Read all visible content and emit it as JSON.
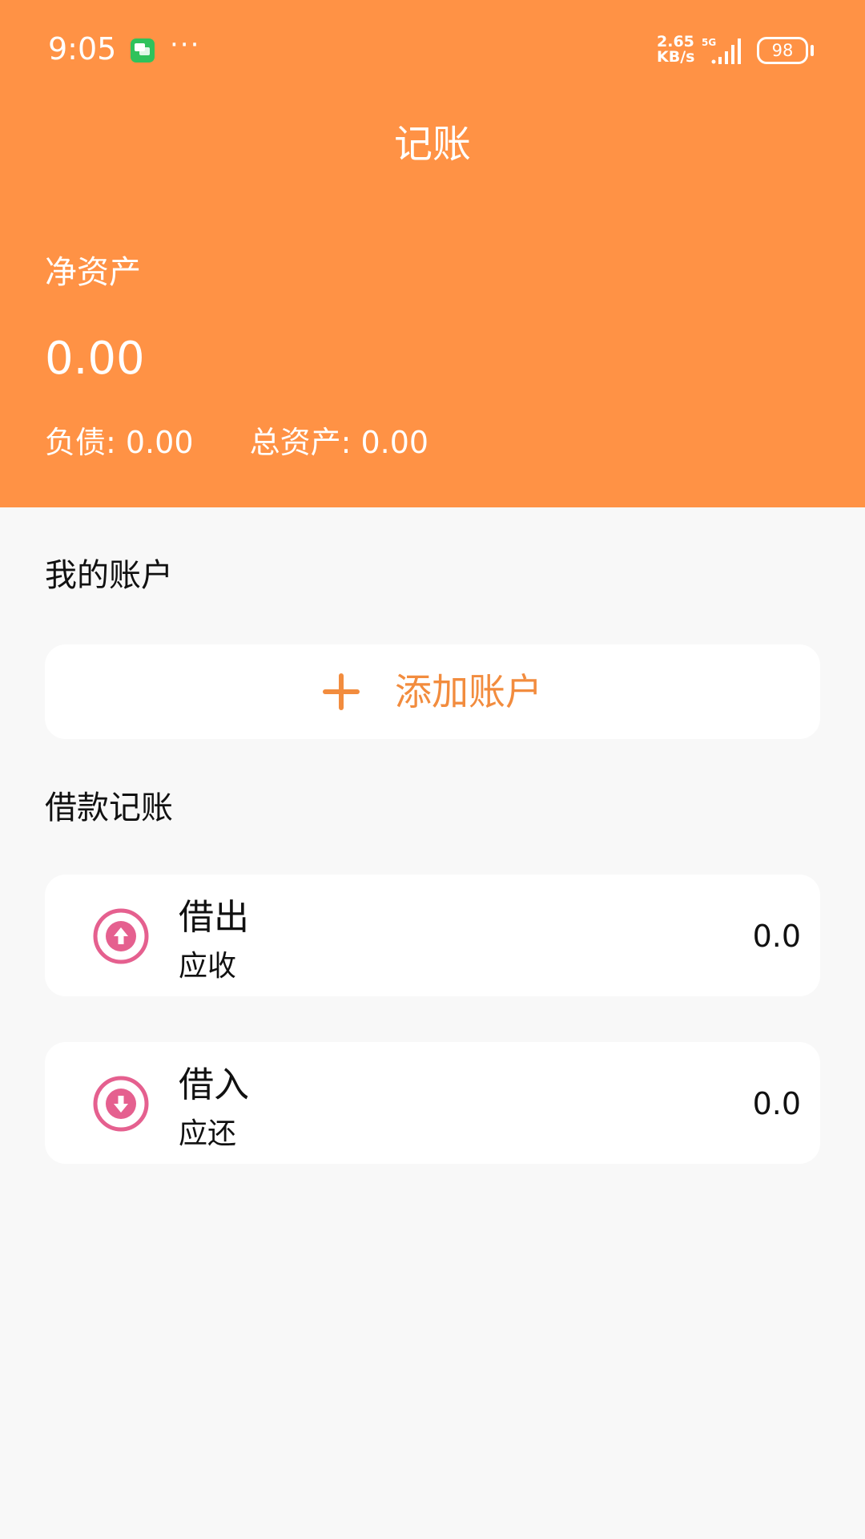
{
  "status_bar": {
    "time": "9:05",
    "more": "···",
    "net_speed": "2.65",
    "net_unit": "KB/s",
    "network_type": "5G",
    "battery": "98"
  },
  "header": {
    "title": "记账",
    "net_assets_label": "净资产",
    "net_assets_value": "0.00",
    "liabilities": "负债: 0.00",
    "total_assets": "总资产: 0.00",
    "background_color": "#ff9245"
  },
  "accounts_section": {
    "title": "我的账户",
    "add_button_label": "添加账户",
    "accent_color": "#f28c3e"
  },
  "loans_section": {
    "title": "借款记账",
    "items": [
      {
        "title": "借出",
        "subtitle": "应收",
        "amount": "0.0",
        "icon": "arrow-up-circle-icon"
      },
      {
        "title": "借入",
        "subtitle": "应还",
        "amount": "0.0",
        "icon": "arrow-down-circle-icon"
      }
    ],
    "icon_color": "#e5608f"
  }
}
